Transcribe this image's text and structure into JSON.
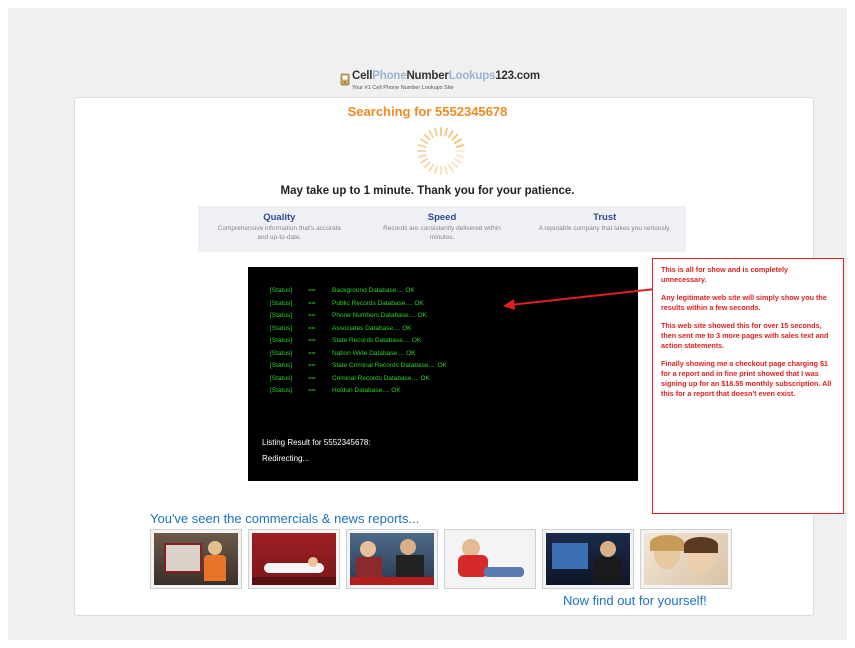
{
  "logo": {
    "part1": "Cell",
    "part2": "Phone",
    "part3": "Number",
    "part4": "Lookups",
    "part5": "123.com",
    "tagline": "Your #1 Cell Phone Number Lookups Site"
  },
  "search": {
    "heading": "Searching for 5552345678",
    "patience": "May take up to 1 minute. Thank you for your patience."
  },
  "features": [
    {
      "title": "Quality",
      "desc": "Comprehensive information that's accurate and up-to-date."
    },
    {
      "title": "Speed",
      "desc": "Records are consistently delivered within minutes."
    },
    {
      "title": "Trust",
      "desc": "A reputable company that takes you seriously."
    }
  ],
  "terminal": {
    "lines": [
      {
        "tag": "[Status]",
        "arrow": "==",
        "text": "Background Database.... OK"
      },
      {
        "tag": "[Status]",
        "arrow": "==",
        "text": "Public Records Database.... OK"
      },
      {
        "tag": "[Status]",
        "arrow": "==",
        "text": "Phone Numbers Database.... OK"
      },
      {
        "tag": "[Status]",
        "arrow": "==",
        "text": "Associates Database.... OK"
      },
      {
        "tag": "[Status]",
        "arrow": "==",
        "text": "State Records Database.... OK"
      },
      {
        "tag": "[Status]",
        "arrow": "==",
        "text": "Nation Wide Database.... OK"
      },
      {
        "tag": "[Status]",
        "arrow": "==",
        "text": "State Criminal Records Database.... OK"
      },
      {
        "tag": "[Status]",
        "arrow": "==",
        "text": "Criminal Records Database.... OK"
      },
      {
        "tag": "[Status]",
        "arrow": "==",
        "text": "Holdon Database.... OK"
      }
    ],
    "listing": "Listing Result for 5552345678:",
    "redirecting": "Redirecting..."
  },
  "annotation": {
    "p1": "This is all for show and is completely unnecessary.",
    "p2": "Any legitimate web site will simply show you the results within a few seconds.",
    "p3": "This web site showed this for over 15 seconds, then sent me to 3 more pages with sales text and action statements.",
    "p4": "Finally showing me a checkout page charging $1 for a report and in fine print showed that I was signing up for an $18.55 monthly subscription.  All this for a report that doesn't even exist."
  },
  "promo": {
    "seen": "You've seen the commercials & news reports...",
    "findout": "Now find out for yourself!"
  },
  "colors": {
    "accent_orange": "#f08a24",
    "terminal_green": "#2ad12a",
    "annotation_red": "#e02020",
    "link_blue": "#1e73be"
  }
}
